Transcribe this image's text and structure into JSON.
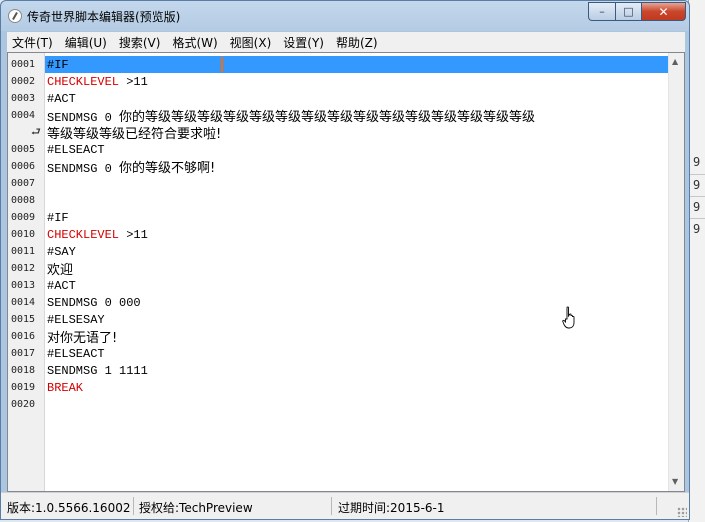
{
  "window": {
    "title": "传奇世界脚本编辑器(预览版)"
  },
  "caption": {
    "min": "–",
    "max": "□",
    "close": "✕"
  },
  "menu": [
    "文件(T)",
    "编辑(U)",
    "搜索(V)",
    "格式(W)",
    "视图(X)",
    "设置(Y)",
    "帮助(Z)"
  ],
  "lines": [
    {
      "num": "0001",
      "text": "#IF",
      "kind": "plain",
      "selected": true
    },
    {
      "num": "0002",
      "text": "CHECKLEVEL",
      "suffix": " >11",
      "kind": "kw"
    },
    {
      "num": "0003",
      "text": "#ACT",
      "kind": "plain"
    },
    {
      "num": "0004",
      "text": "SENDMSG 0 ",
      "cjk": "你的等级等级等级等级等级等级等级等级等级等级等级等级等级等级等级",
      "kind": "mixed"
    },
    {
      "num": "",
      "text": "",
      "cjk": "等级等级等级已经符合要求啦!",
      "kind": "wrap"
    },
    {
      "num": "0005",
      "text": "#ELSEACT",
      "kind": "plain"
    },
    {
      "num": "0006",
      "text": "SENDMSG 0 ",
      "cjk": "你的等级不够啊!",
      "kind": "mixed"
    },
    {
      "num": "0007",
      "text": "",
      "kind": "plain"
    },
    {
      "num": "0008",
      "text": "",
      "kind": "plain"
    },
    {
      "num": "0009",
      "text": "#IF",
      "kind": "plain"
    },
    {
      "num": "0010",
      "text": "CHECKLEVEL",
      "suffix": " >11",
      "kind": "kw"
    },
    {
      "num": "0011",
      "text": "#SAY",
      "kind": "plain"
    },
    {
      "num": "0012",
      "text": "",
      "cjk": "欢迎",
      "kind": "mixed"
    },
    {
      "num": "0013",
      "text": "#ACT",
      "kind": "plain"
    },
    {
      "num": "0014",
      "text": "SENDMSG 0 000",
      "kind": "plain"
    },
    {
      "num": "0015",
      "text": "#ELSESAY",
      "kind": "plain"
    },
    {
      "num": "0016",
      "text": "",
      "cjk": "对你无语了!",
      "kind": "mixed"
    },
    {
      "num": "0017",
      "text": "#ELSEACT",
      "kind": "plain"
    },
    {
      "num": "0018",
      "text": "SENDMSG 1 1111",
      "kind": "plain"
    },
    {
      "num": "0019",
      "text": "BREAK",
      "kind": "kw"
    },
    {
      "num": "0020",
      "text": "",
      "kind": "plain"
    }
  ],
  "status": {
    "version": "版本:1.0.5566.16002",
    "licensed": "授权给:TechPreview",
    "expires": "过期时间:2015-6-1"
  },
  "behind_digits": [
    "9",
    "9",
    "9",
    "9"
  ]
}
